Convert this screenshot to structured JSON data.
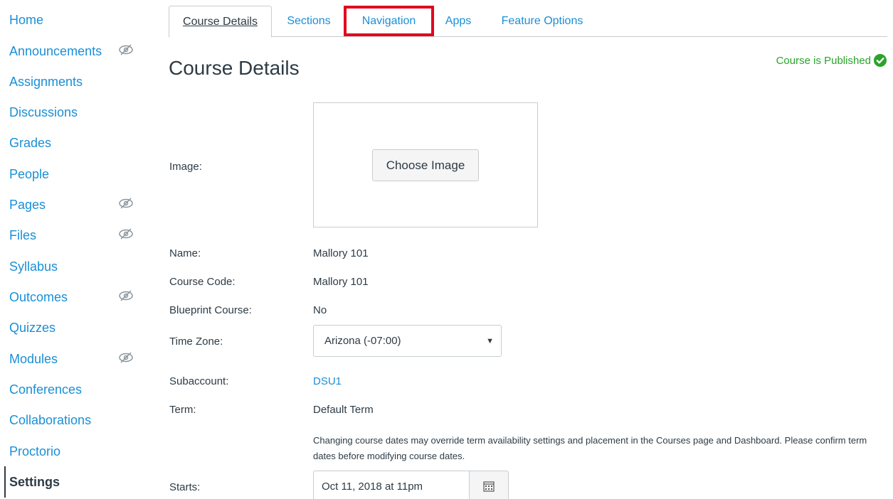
{
  "sidebar": {
    "items": [
      {
        "label": "Home",
        "hidden": false
      },
      {
        "label": "Announcements",
        "hidden": true
      },
      {
        "label": "Assignments",
        "hidden": false
      },
      {
        "label": "Discussions",
        "hidden": false
      },
      {
        "label": "Grades",
        "hidden": false
      },
      {
        "label": "People",
        "hidden": false
      },
      {
        "label": "Pages",
        "hidden": true
      },
      {
        "label": "Files",
        "hidden": true
      },
      {
        "label": "Syllabus",
        "hidden": false
      },
      {
        "label": "Outcomes",
        "hidden": true
      },
      {
        "label": "Quizzes",
        "hidden": false
      },
      {
        "label": "Modules",
        "hidden": true
      },
      {
        "label": "Conferences",
        "hidden": false
      },
      {
        "label": "Collaborations",
        "hidden": false
      },
      {
        "label": "Proctorio",
        "hidden": false
      },
      {
        "label": "Settings",
        "hidden": false,
        "active": true
      }
    ],
    "hidden_icon": "eye-slash-icon"
  },
  "tabs": [
    {
      "label": "Course Details",
      "active": true
    },
    {
      "label": "Sections"
    },
    {
      "label": "Navigation",
      "highlighted": true
    },
    {
      "label": "Apps"
    },
    {
      "label": "Feature Options"
    }
  ],
  "page": {
    "title": "Course Details",
    "published_status": "Course is Published"
  },
  "form": {
    "image_label": "Image:",
    "choose_image": "Choose Image",
    "name_label": "Name:",
    "name_value": "Mallory 101",
    "course_code_label": "Course Code:",
    "course_code_value": "Mallory 101",
    "blueprint_label": "Blueprint Course:",
    "blueprint_value": "No",
    "timezone_label": "Time Zone:",
    "timezone_value": "Arizona (-07:00)",
    "subaccount_label": "Subaccount:",
    "subaccount_value": "DSU1",
    "term_label": "Term:",
    "term_value": "Default Term",
    "date_warning": "Changing course dates may override term availability settings and placement in the Courses page and Dashboard. Please confirm term dates before modifying course dates.",
    "starts_label": "Starts:",
    "starts_value": "Oct 11, 2018 at 11pm"
  },
  "colors": {
    "link": "#1a8fd6",
    "text": "#2d3b45",
    "published": "#2aa32a",
    "highlight": "#e0061f"
  }
}
